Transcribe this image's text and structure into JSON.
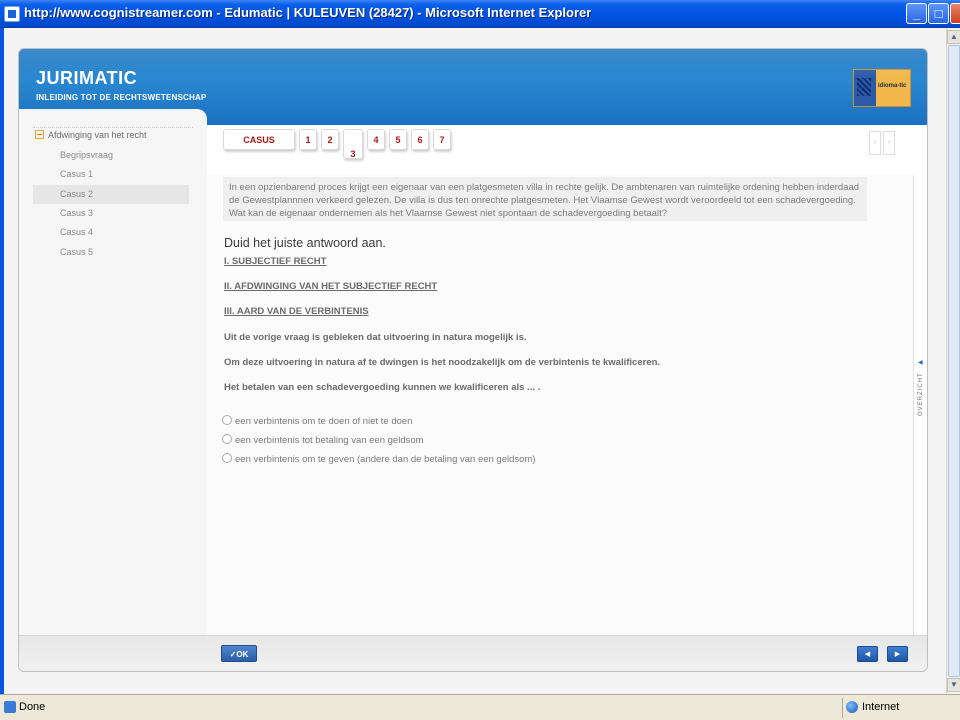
{
  "window": {
    "title": "http://www.cognistreamer.com - Edumatic | KULEUVEN (28427) - Microsoft Internet Explorer",
    "btn_min": "_",
    "btn_max": "□",
    "btn_close": "✕"
  },
  "status": {
    "left": "Done",
    "zone": "Internet"
  },
  "app": {
    "title": "JURIMATIC",
    "subtitle": "INLEIDING TOT DE RECHTSWETENSCHAP",
    "logo_text": "idioma-tic"
  },
  "sidebar": {
    "root_label": "Afdwinging van het recht",
    "items": [
      {
        "label": "Begripsvraag"
      },
      {
        "label": "Casus 1"
      },
      {
        "label": "Casus 2"
      },
      {
        "label": "Casus 3"
      },
      {
        "label": "Casus 4"
      },
      {
        "label": "Casus 5"
      }
    ],
    "active_index": 2
  },
  "tabs": {
    "casus": "CASUS",
    "numbers": [
      "1",
      "2",
      "3",
      "4",
      "5",
      "6",
      "7"
    ],
    "selected": "3",
    "nav_prev": "‹",
    "nav_next": "›"
  },
  "main": {
    "question": "In een opzienbarend proces krijgt een eigenaar van een platgesmeten villa in rechte gelijk. De ambtenaren van ruimtelijke ordening hebben inderdaad de Gewestplannnen verkeerd gelezen. De  villa is dus ten onrechte platgesmeten. Het Vlaamse Gewest wordt veroordeeld tot een schadevergoeding. Wat kan de eigenaar ondernemen als het Vlaamse Gewest niet spontaan de schadevergoeding betaalt?",
    "prompt": "Duid het juiste antwoord aan.",
    "heading1": "I. SUBJECTIEF RECHT",
    "heading2": "II. AFDWINGING VAN HET SUBJECTIEF RECHT",
    "heading3": "III. AARD VAN DE VERBINTENIS",
    "para1": "Uit de vorige vraag is gebleken dat uitvoering in natura mogelijk is.",
    "para2": "Om deze uitvoering in natura af te dwingen is het noodzakelijk om de verbintenis te kwalificeren.",
    "para3": "Het betalen van een schadevergoeding kunnen we kwalificeren als ... .",
    "options": [
      {
        "label": "een verbintenis om te doen of niet te doen"
      },
      {
        "label": "een verbintenis tot betaling van een geldsom"
      },
      {
        "label": "een verbintenis om te geven (andere dan de betaling van een geldsom)"
      }
    ]
  },
  "overzicht": {
    "label": "OVERZICHT",
    "arrow": "◀"
  },
  "footer": {
    "ok": "✓OK",
    "prev": "◀",
    "next": "▶"
  }
}
